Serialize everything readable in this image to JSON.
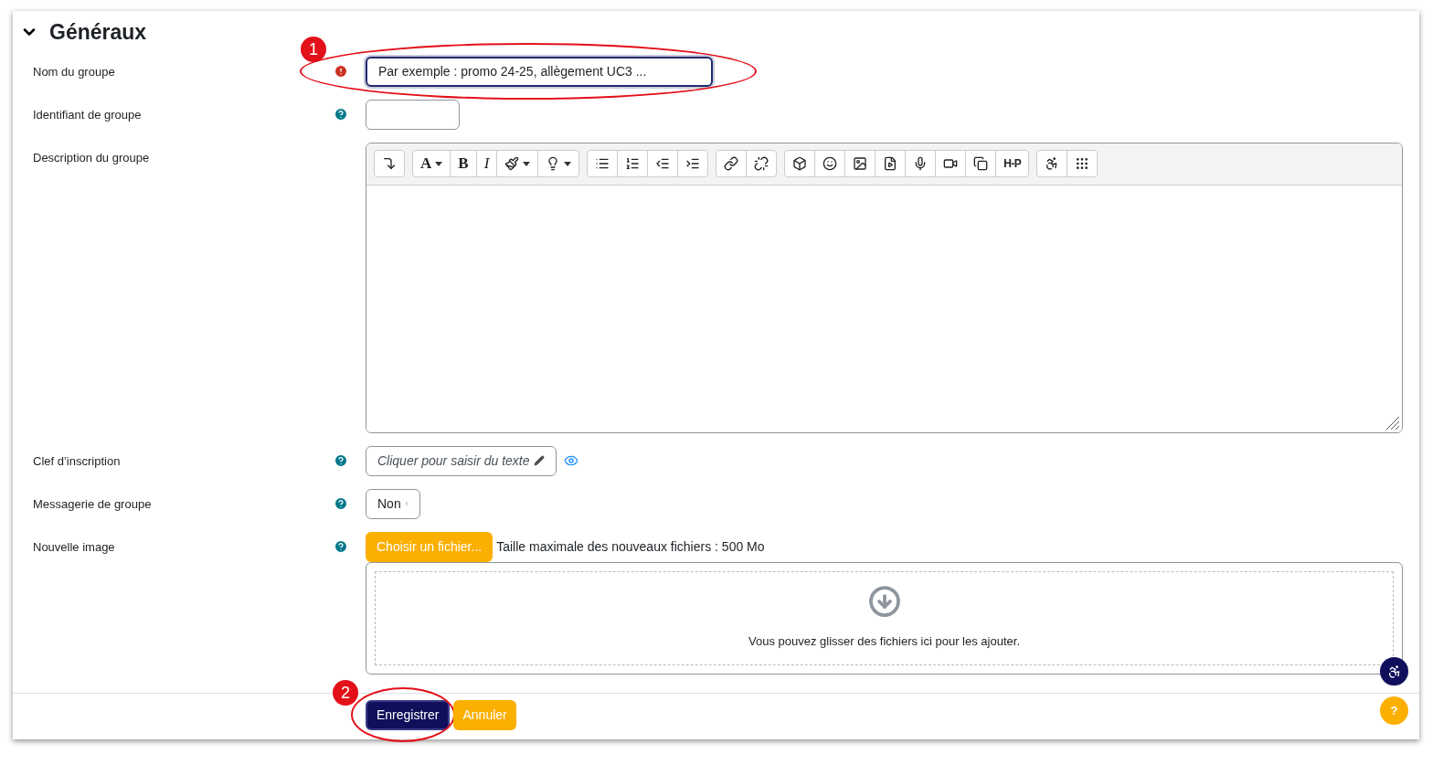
{
  "section": {
    "title": "Généraux",
    "expanded": true
  },
  "fields": [
    {
      "kind": "text",
      "label": "Nom du groupe",
      "required": true,
      "help": false,
      "value": "Par exemple : promo 24-25, allègement UC3 ...",
      "focused": true,
      "callout": "1"
    },
    {
      "kind": "text",
      "label": "Identifiant de groupe",
      "required": false,
      "help": true,
      "focused": false
    },
    {
      "kind": "editor",
      "label": "Description du groupe",
      "required": false,
      "help": false
    },
    {
      "kind": "inline",
      "label": "Clef d’inscription",
      "required": false,
      "help": true,
      "text": "Cliquer pour saisir du texte"
    },
    {
      "kind": "select",
      "label": "Messagerie de groupe",
      "required": false,
      "help": true,
      "value": "Non"
    },
    {
      "kind": "file",
      "label": "Nouvelle image",
      "required": false,
      "help": true,
      "button": "Choisir un fichier...",
      "note": "Taille maximale des nouveaux fichiers : 500 Mo",
      "drop_text": "Vous pouvez glisser des fichiers ici pour les ajouter."
    }
  ],
  "editor_toolbar": [
    [
      {
        "kind": "icon",
        "caret": false
      }
    ],
    [
      {
        "kind": "text",
        "label": "A",
        "caret": true
      },
      {
        "kind": "text",
        "label": "B",
        "caret": false
      },
      {
        "kind": "text",
        "label": "I",
        "caret": false
      },
      {
        "kind": "icon",
        "caret": true
      },
      {
        "kind": "icon",
        "caret": true
      }
    ],
    [
      {
        "kind": "icon",
        "caret": false
      },
      {
        "kind": "icon",
        "caret": false
      },
      {
        "kind": "icon",
        "caret": false
      },
      {
        "kind": "icon",
        "caret": false
      }
    ],
    [
      {
        "kind": "icon",
        "caret": false
      },
      {
        "kind": "icon",
        "caret": false
      }
    ],
    [
      {
        "kind": "icon",
        "caret": false
      },
      {
        "kind": "icon",
        "caret": false
      },
      {
        "kind": "icon",
        "caret": false
      },
      {
        "kind": "icon",
        "caret": false
      },
      {
        "kind": "icon",
        "caret": false
      },
      {
        "kind": "icon",
        "caret": false
      },
      {
        "kind": "icon",
        "caret": false
      },
      {
        "kind": "text",
        "label": "H-P",
        "caret": false
      }
    ],
    [
      {
        "kind": "icon",
        "caret": false
      },
      {
        "kind": "icon",
        "caret": false
      }
    ]
  ],
  "actions": [
    {
      "label": "Enregistrer",
      "kind": "primary",
      "callout": "2"
    },
    {
      "label": "Annuler",
      "kind": "secondary"
    }
  ],
  "floating": [
    {
      "kind": "accessibility"
    },
    {
      "kind": "help",
      "label": "?"
    }
  ]
}
